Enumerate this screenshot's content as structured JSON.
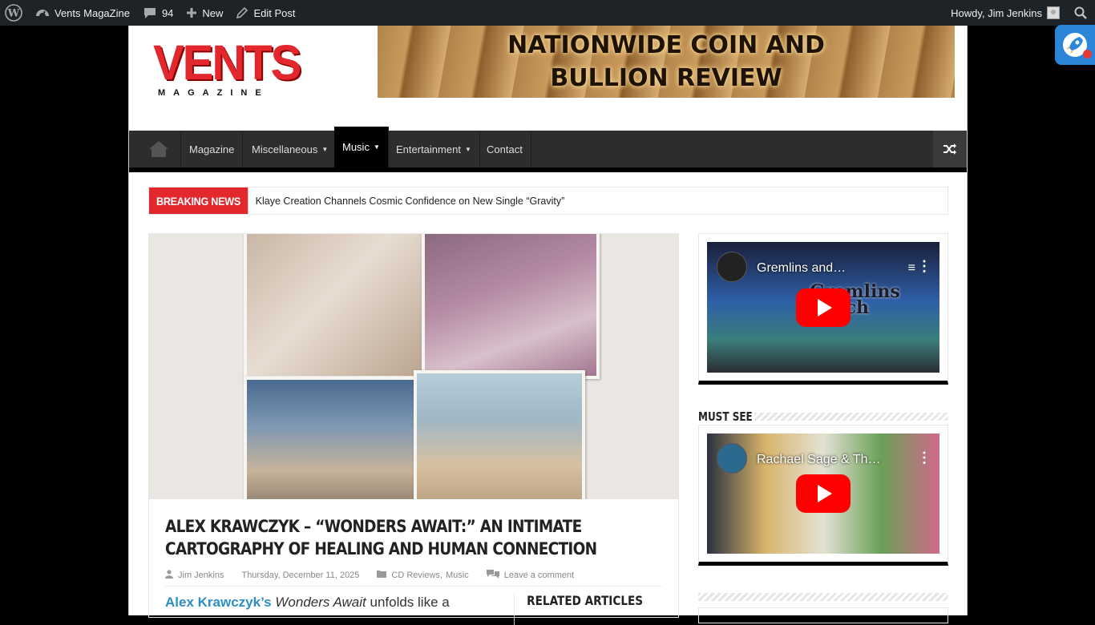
{
  "adminbar": {
    "site_name": "Vents MagaZine",
    "comments_count": "94",
    "new_label": "New",
    "edit_label": "Edit Post",
    "greeting": "Howdy, Jim Jenkins"
  },
  "header": {
    "logo_big": "VENTS",
    "logo_small": "MAGAZINE",
    "banner_line1": "NATIONWIDE COIN AND",
    "banner_line2": "BULLION REVIEW"
  },
  "nav": {
    "items": [
      {
        "label": "Magazine",
        "caret": false
      },
      {
        "label": "Miscellaneous",
        "caret": true
      },
      {
        "label": "Music",
        "caret": true
      },
      {
        "label": "Entertainment",
        "caret": true
      },
      {
        "label": "Contact",
        "caret": false
      }
    ]
  },
  "breaking": {
    "tag": "BREAKING NEWS",
    "headline": "Klaye Creation Channels Cosmic Confidence on New Single “Gravity”"
  },
  "post": {
    "title": "Alex Krawczyk – “Wonders Await:” An Intimate Cartography of Healing and Human Connection",
    "author": "Jim Jenkins",
    "date": "Thursday, December 11, 2025",
    "cat1": "CD Reviews",
    "cat_sep": ",",
    "cat2": "Music",
    "comment": "Leave a comment",
    "excerpt_link": "Alex Krawczyk’s",
    "excerpt_italic": "Wonders Await",
    "excerpt_rest": "unfolds like a",
    "related_heading": "Related Articles"
  },
  "sidebar": {
    "video1_title": "Gremlins and…",
    "video1_overlay": "Gremlins\nStitch",
    "must_see": "Must See",
    "video2_title": "Rachael Sage & Th…"
  },
  "colors": {
    "accent_red": "#e3282d",
    "nav_bg": "#2d2d2d",
    "link_blue": "#2c8ec5",
    "admin_bar": "#1d2327"
  }
}
